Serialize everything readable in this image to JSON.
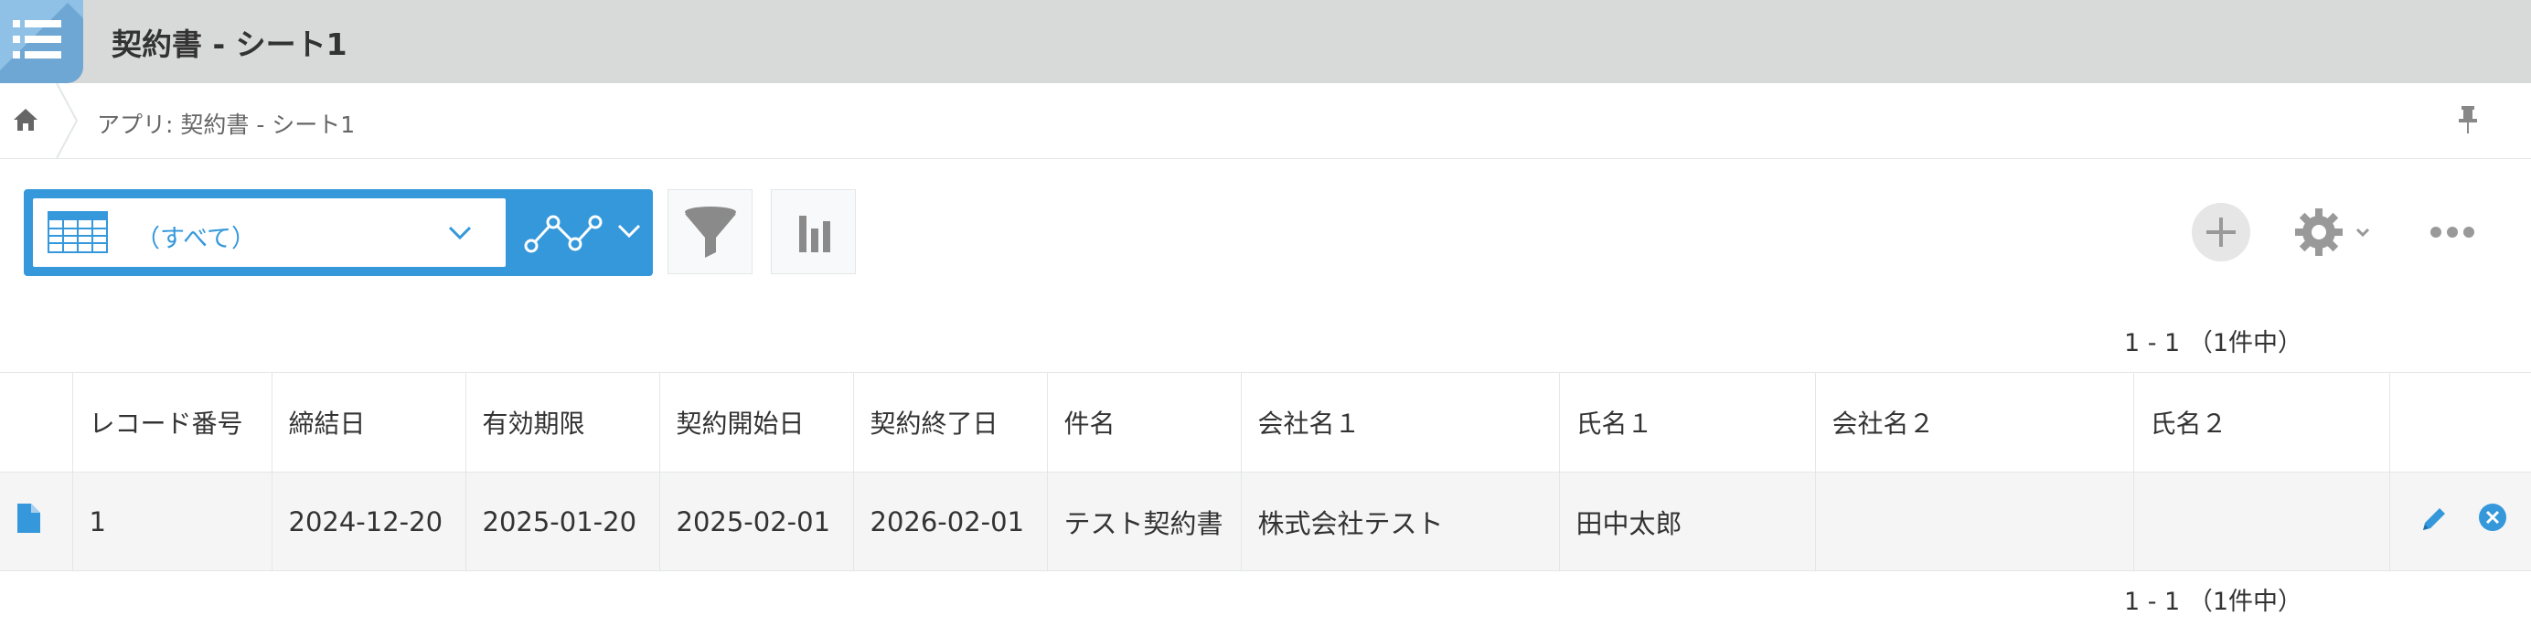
{
  "header": {
    "title": "契約書 - シート1",
    "app_icon": "list-icon",
    "accent_color": "#8fc1e6"
  },
  "breadcrumb": {
    "home_icon": "home-icon",
    "text": "アプリ: 契約書 - シート1",
    "pin_icon": "pin-icon"
  },
  "toolbar": {
    "view_select": {
      "icon": "table-view-icon",
      "selected": "（すべて）"
    },
    "graph_icon": "line-graph-icon",
    "filter_icon": "filter-icon",
    "chart_icon": "bar-chart-icon",
    "add_icon": "plus-icon",
    "settings_icon": "gear-icon",
    "more_icon": "more-icon",
    "primary_color": "#3498db"
  },
  "pagination": {
    "top": "1 - 1 （1件中）",
    "bottom": "1 - 1 （1件中）"
  },
  "table": {
    "columns": [
      "",
      "レコード番号",
      "締結日",
      "有効期限",
      "契約開始日",
      "契約終了日",
      "件名",
      "会社名１",
      "氏名１",
      "会社名２",
      "氏名２",
      ""
    ],
    "rows": [
      {
        "detail_icon": "document-icon",
        "cells": [
          "1",
          "2024-12-20",
          "2025-01-20",
          "2025-02-01",
          "2026-02-01",
          "テスト契約書",
          "株式会社テスト",
          "田中太郎",
          "",
          ""
        ],
        "actions": [
          "edit-icon",
          "delete-icon"
        ]
      }
    ]
  }
}
